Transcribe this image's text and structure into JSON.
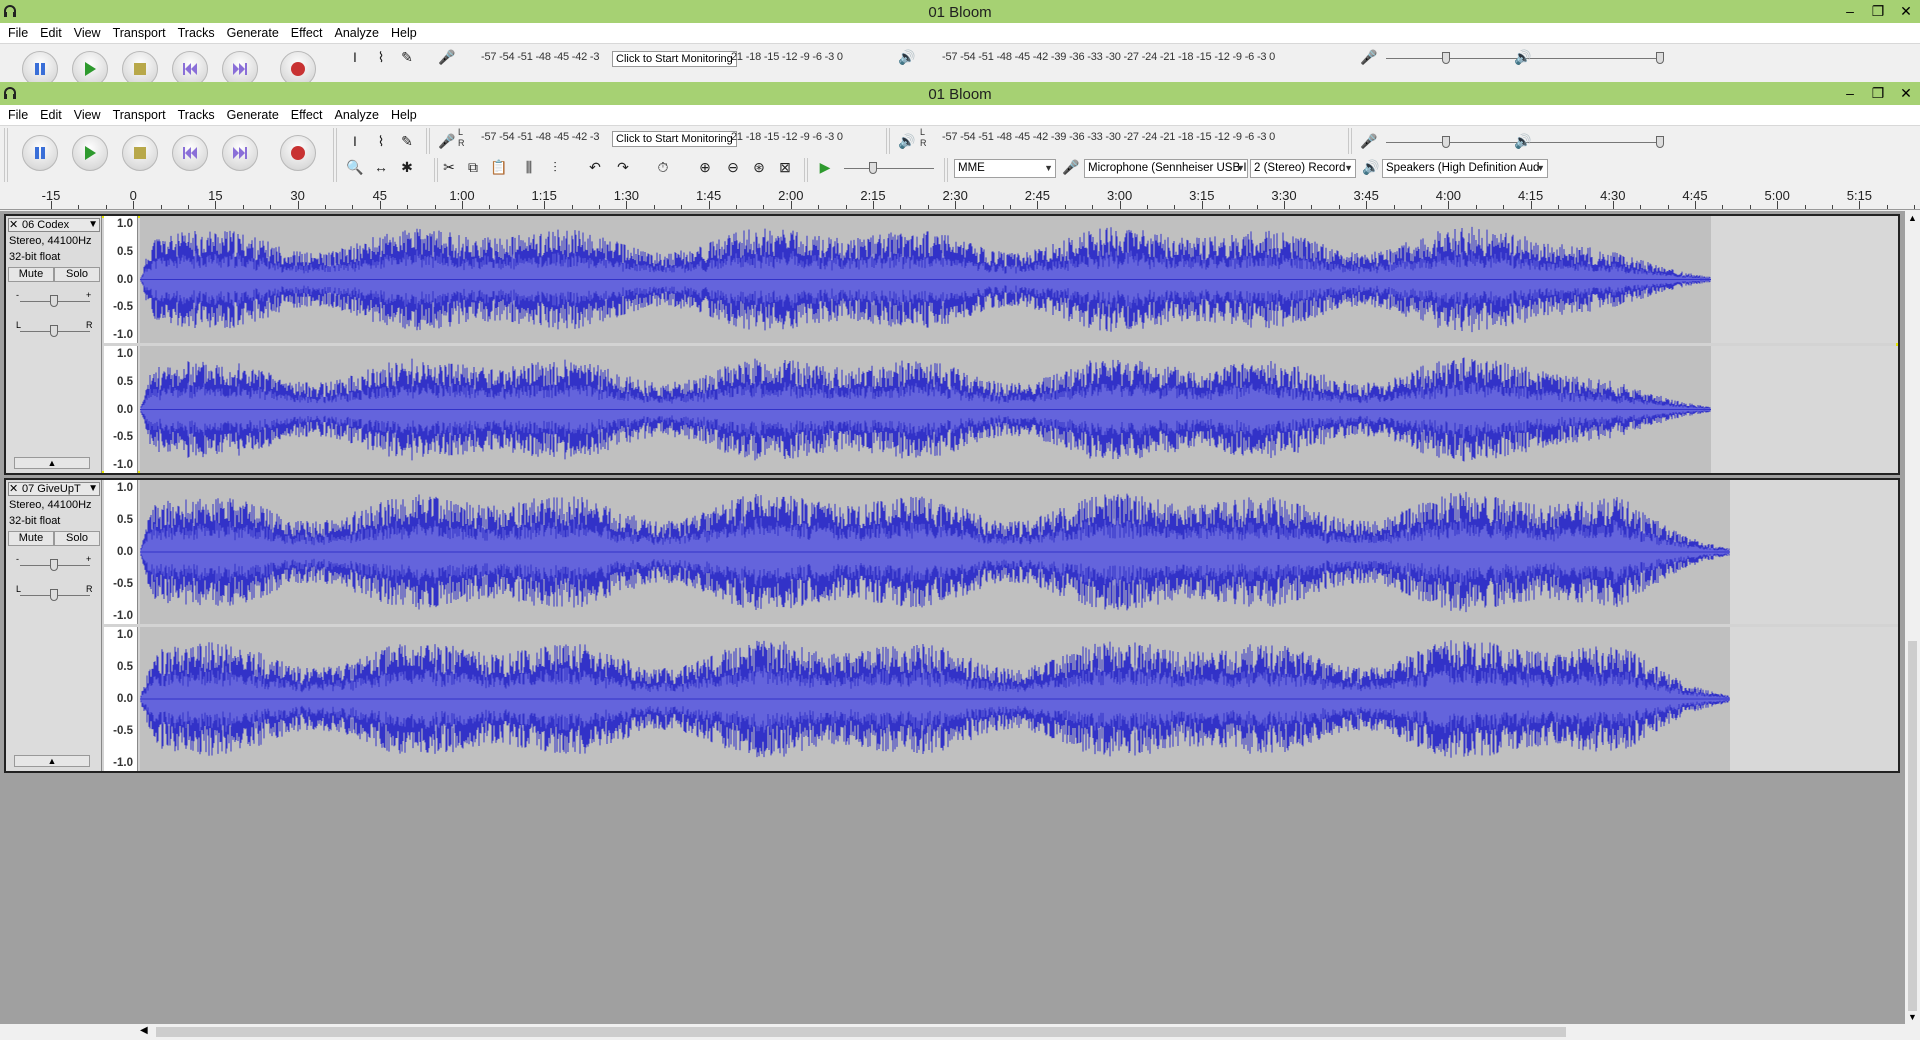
{
  "window_back": {
    "title": "01 Bloom"
  },
  "window_front": {
    "title": "01 Bloom"
  },
  "menus": [
    "File",
    "Edit",
    "View",
    "Transport",
    "Tracks",
    "Generate",
    "Effect",
    "Analyze",
    "Help"
  ],
  "transport": {
    "pause": "Pause",
    "play": "Play",
    "stop": "Stop",
    "skip_start": "Skip to Start",
    "skip_end": "Skip to End",
    "record": "Record"
  },
  "meters": {
    "record_scale": "-57 -54 -51 -48 -45 -42 -3",
    "record_tip": "Click to Start Monitoring",
    "record_scale_end": "21 -18 -15 -12 -9 -6 -3 0",
    "play_scale": "-57 -54 -51 -48 -45 -42 -39 -36 -33 -30 -27 -24 -21 -18 -15 -12 -9 -6 -3 0",
    "lr_top": "L",
    "lr_bottom": "R"
  },
  "devices": {
    "host": "MME",
    "microphone": "Microphone (Sennheiser USB I",
    "channels": "2 (Stereo) Record",
    "speakers": "Speakers (High Definition Aud"
  },
  "ruler": {
    "labels": [
      "-15",
      "0",
      "15",
      "30",
      "45",
      "1:00",
      "1:15",
      "1:30",
      "1:45",
      "2:00",
      "2:15",
      "2:30",
      "2:45",
      "3:00",
      "3:15",
      "3:30",
      "3:45",
      "4:00",
      "4:15",
      "4:30",
      "4:45",
      "5:00",
      "5:15"
    ]
  },
  "tracks": [
    {
      "name": "06 Codex",
      "info1": "Stereo, 44100Hz",
      "info2": "32-bit float",
      "mute": "Mute",
      "solo": "Solo",
      "gain_minus": "-",
      "gain_plus": "+",
      "pan_l": "L",
      "pan_r": "R"
    },
    {
      "name": "07 GiveUpT",
      "info1": "Stereo, 44100Hz",
      "info2": "32-bit float",
      "mute": "Mute",
      "solo": "Solo",
      "gain_minus": "-",
      "gain_plus": "+",
      "pan_l": "L",
      "pan_r": "R"
    }
  ],
  "scale_labels": [
    "1.0",
    "0.5",
    "0.0",
    "-0.5",
    "-1.0"
  ],
  "colors": {
    "titlebar": "#a6d173",
    "waveform": "#3232c8",
    "waveform_rms": "#6464dc",
    "selected_border": "#e6e600"
  }
}
